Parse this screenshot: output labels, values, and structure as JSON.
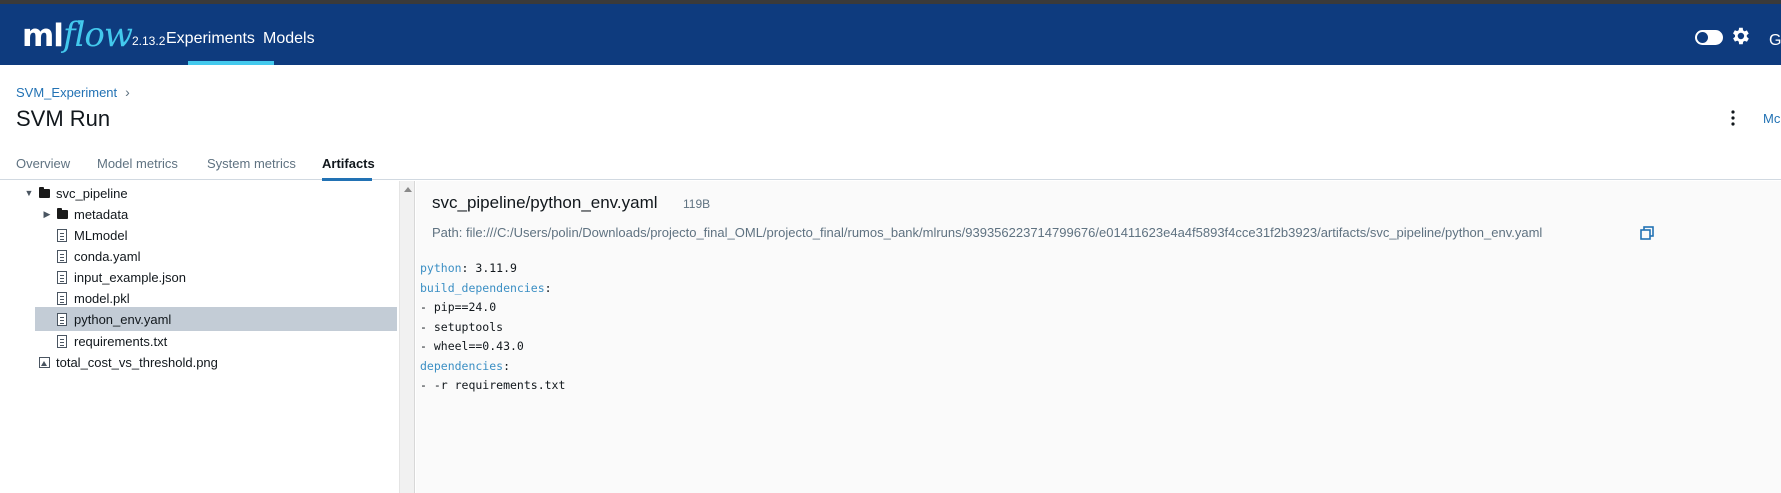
{
  "navbar": {
    "logo_ml": "ml",
    "logo_flow": "flow",
    "version": "2.13.2",
    "links": [
      "Experiments",
      "Models"
    ],
    "right_edge_text": "G",
    "icons": [
      "theme-toggle",
      "gear-icon"
    ]
  },
  "breadcrumb": {
    "experiment": "SVM_Experiment",
    "separator": "›"
  },
  "run": {
    "title": "SVM Run",
    "right_edge_link": "Mc"
  },
  "tabs": [
    "Overview",
    "Model metrics",
    "System metrics",
    "Artifacts"
  ],
  "active_tab": "Artifacts",
  "tree": [
    {
      "label": "svc_pipeline",
      "type": "folder",
      "expanded": true
    },
    {
      "label": "metadata",
      "type": "folder",
      "expanded": false
    },
    {
      "label": "MLmodel",
      "type": "file"
    },
    {
      "label": "conda.yaml",
      "type": "file"
    },
    {
      "label": "input_example.json",
      "type": "file"
    },
    {
      "label": "model.pkl",
      "type": "file"
    },
    {
      "label": "python_env.yaml",
      "type": "file",
      "selected": true
    },
    {
      "label": "requirements.txt",
      "type": "file"
    },
    {
      "label": "total_cost_vs_threshold.png",
      "type": "image"
    }
  ],
  "artifact": {
    "name": "svc_pipeline/python_env.yaml",
    "size": "119B",
    "path": "Path: file:///C:/Users/polin/Downloads/projecto_final_OML/projecto_final/rumos_bank/mlruns/939356223714799676/e01411623e4a4f5893f4cce31f2b3923/artifacts/svc_pipeline/python_env.yaml",
    "code": {
      "python_key": "python",
      "python_val": " 3.11.9",
      "build_key": "build_dependencies",
      "build_items": [
        "- pip==24.0",
        "- setuptools",
        "- wheel==0.43.0"
      ],
      "deps_key": "dependencies",
      "deps_items": [
        "- -r requirements.txt"
      ]
    }
  },
  "colors": {
    "navbar": "#0e3b7e",
    "accent": "#43c9ed",
    "link": "#2272b4",
    "selected_row": "#c3ccd6"
  }
}
